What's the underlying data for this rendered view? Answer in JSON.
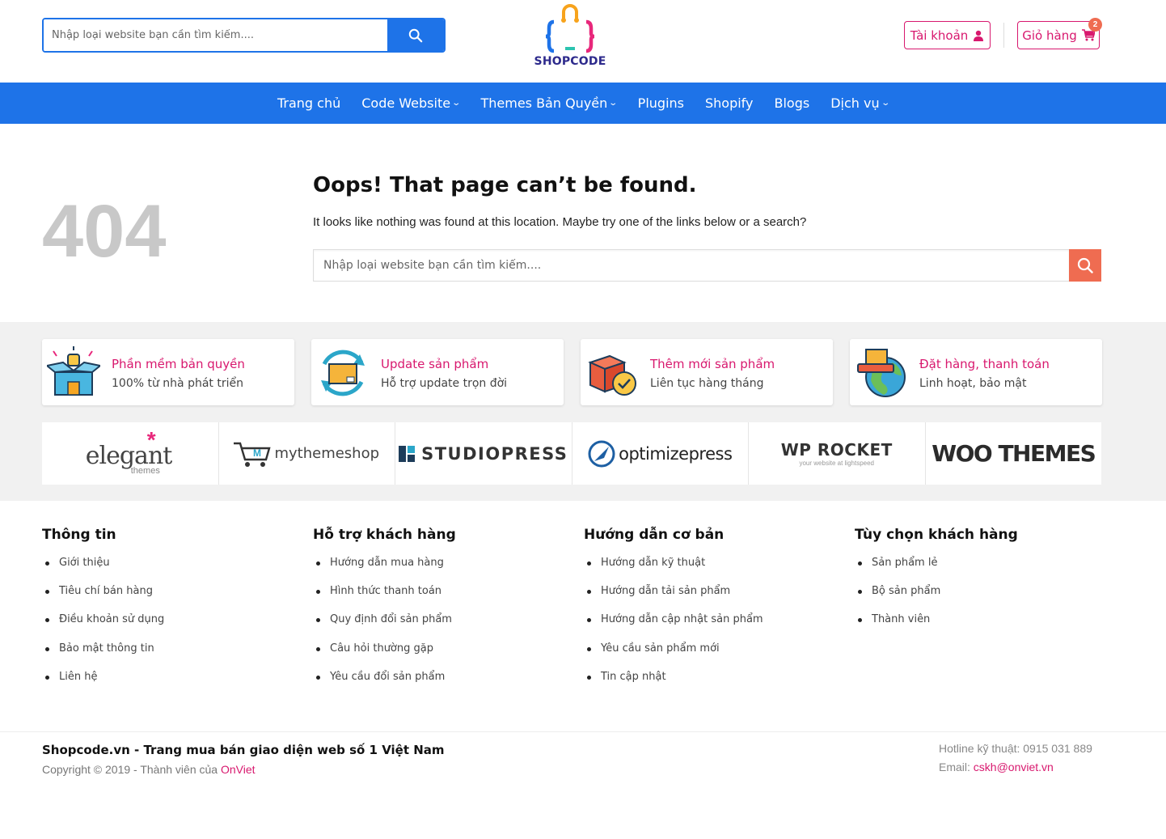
{
  "header": {
    "search_placeholder": "Nhập loại website bạn cần tìm kiếm....",
    "logo_text": "SHOPCODE",
    "account_label": "Tài khoản",
    "cart_label": "Giỏ hàng",
    "cart_count": "2"
  },
  "nav": {
    "items": [
      {
        "label": "Trang chủ",
        "dropdown": false
      },
      {
        "label": "Code Website",
        "dropdown": true
      },
      {
        "label": "Themes Bản Quyền",
        "dropdown": true
      },
      {
        "label": "Plugins",
        "dropdown": false
      },
      {
        "label": "Shopify",
        "dropdown": false
      },
      {
        "label": "Blogs",
        "dropdown": false
      },
      {
        "label": "Dịch vụ",
        "dropdown": true
      }
    ]
  },
  "error": {
    "code": "404",
    "title": "Oops! That page can’t be found.",
    "message": "It looks like nothing was found at this location. Maybe try one of the links below or a search?",
    "search_placeholder": "Nhập loại website bạn cần tìm kiếm...."
  },
  "features": [
    {
      "title": "Phần mềm bản quyền",
      "subtitle": "100% từ nhà phát triển",
      "icon": "open-box-icon"
    },
    {
      "title": "Update sản phẩm",
      "subtitle": "Hỗ trợ update trọn đời",
      "icon": "box-refresh-icon"
    },
    {
      "title": "Thêm mới sản phẩm",
      "subtitle": "Liên tục hàng tháng",
      "icon": "new-box-icon"
    },
    {
      "title": "Đặt hàng, thanh toán",
      "subtitle": "Linh hoạt, bảo mật",
      "icon": "globe-delivery-icon"
    }
  ],
  "brands": [
    {
      "name": "elegant",
      "sub": "themes"
    },
    {
      "name": "mythemeshop"
    },
    {
      "name": "STUDIOPRESS"
    },
    {
      "name": "optimizepress"
    },
    {
      "name": "WP ROCKET",
      "sub": "your website at lightspeed"
    },
    {
      "name": "WOO THEMES"
    }
  ],
  "footer": {
    "columns": [
      {
        "title": "Thông tin",
        "links": [
          "Giới thiệu",
          "Tiêu chí bán hàng",
          "Điều khoản sử dụng",
          "Bảo mật thông tin",
          "Liên hệ"
        ]
      },
      {
        "title": "Hỗ trợ khách hàng",
        "links": [
          "Hướng dẫn mua hàng",
          "Hình thức thanh toán",
          "Quy định đổi sản phẩm",
          "Câu hỏi thường gặp",
          "Yêu cầu đổi sản phẩm"
        ]
      },
      {
        "title": "Hướng dẫn cơ bản",
        "links": [
          "Hướng dẫn kỹ thuật",
          "Hướng dẫn tải sản phẩm",
          "Hướng dẫn cập nhật sản phẩm",
          "Yêu cầu sản phẩm mới",
          "Tin cập nhật"
        ]
      },
      {
        "title": "Tùy chọn khách hàng",
        "links": [
          "Sản phẩm lẻ",
          "Bộ sản phẩm",
          "Thành viên"
        ]
      }
    ],
    "tagline": "Shopcode.vn - Trang mua bán giao diện web số 1 Việt Nam",
    "copyright": "Copyright © 2019 - Thành viên của ",
    "copyright_link": "OnViet",
    "hotline": "Hotline kỹ thuật: 0915 031 889",
    "email_label": "Email: ",
    "email": "cskh@onviet.vn"
  },
  "colors": {
    "primary": "#1e73e8",
    "accent": "#d8186e",
    "search_button": "#ef6c51",
    "band_bg": "#f1f1f1"
  }
}
